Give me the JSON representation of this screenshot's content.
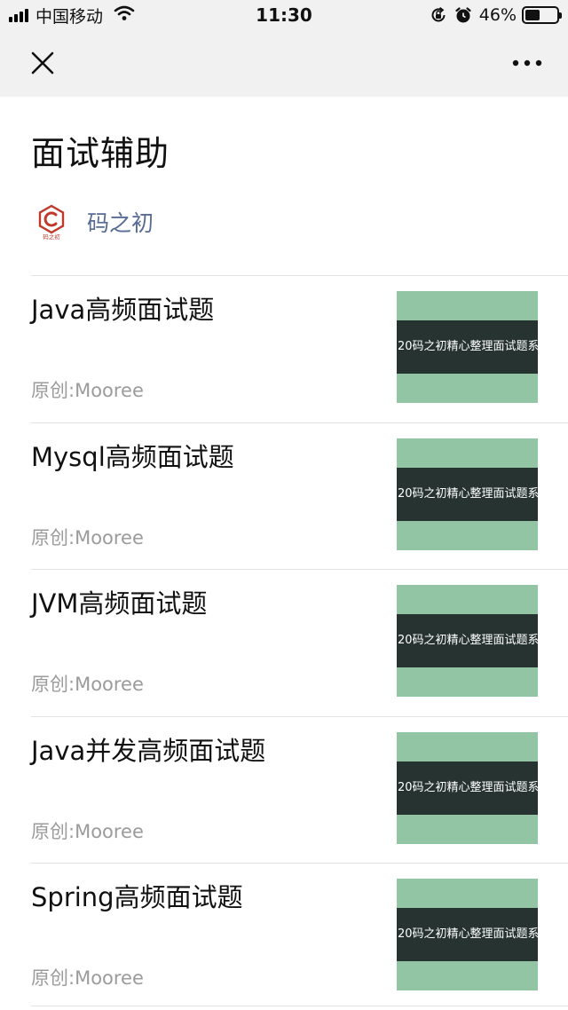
{
  "status_bar": {
    "carrier": "中国移动",
    "time": "11:30",
    "battery_percent": "46%",
    "battery_level": 0.46,
    "icons": [
      "signal-icon",
      "wifi-icon",
      "rotation-lock-icon",
      "alarm-icon",
      "battery-icon"
    ]
  },
  "nav": {
    "close_icon": "close-icon",
    "more_icon": "more-icon"
  },
  "page": {
    "title": "面试辅助"
  },
  "account": {
    "avatar_icon": "account-logo",
    "avatar_text": "码之初",
    "name": "码之初"
  },
  "articles": [
    {
      "title": "Java高频面试题",
      "meta": "原创:Mooree",
      "thumb_text": "20码之初精心整理面试题系"
    },
    {
      "title": "Mysql高频面试题",
      "meta": "原创:Mooree",
      "thumb_text": "20码之初精心整理面试题系"
    },
    {
      "title": "JVM高频面试题",
      "meta": "原创:Mooree",
      "thumb_text": "20码之初精心整理面试题系"
    },
    {
      "title": "Java并发高频面试题",
      "meta": "原创:Mooree",
      "thumb_text": "20码之初精心整理面试题系"
    },
    {
      "title": "Spring高频面试题",
      "meta": "原创:Mooree",
      "thumb_text": "20码之初精心整理面试题系"
    }
  ],
  "colors": {
    "nav_background": "#f1f1f1",
    "account_name": "#576b95",
    "meta_text": "#9b9b9b",
    "thumb_green": "#92c5a4",
    "thumb_band": "#263330",
    "divider": "#e3e3e3"
  }
}
